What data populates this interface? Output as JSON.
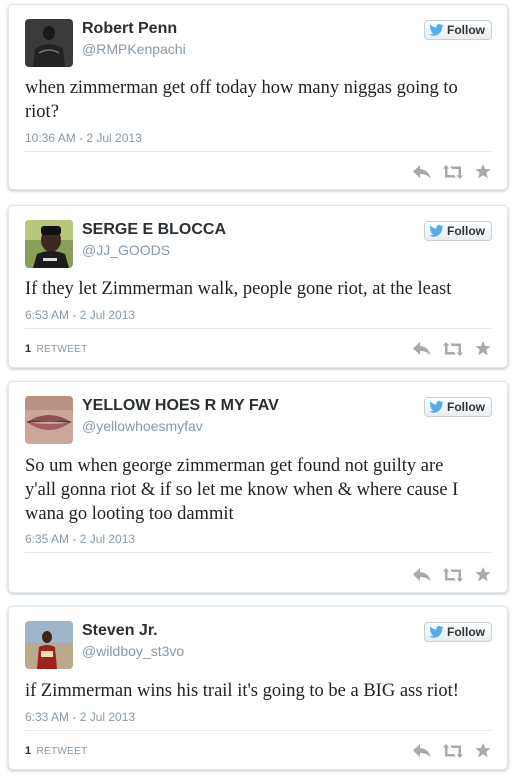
{
  "colors": {
    "follow_bird": "#55acee",
    "action_icon": "#a9a9a9",
    "handle": "#8899a6"
  },
  "tweets": [
    {
      "name": "Robert Penn",
      "handle": "@RMPKenpachi",
      "follow_label": "Follow",
      "text_lines": [
        "when zimmerman get off today how many niggas going to",
        "riot?"
      ],
      "timestamp": "10:36 AM - 2 Jul 2013",
      "retweet_count": "",
      "retweet_label": ""
    },
    {
      "name": "SERGE E BLOCCA",
      "handle": "@JJ_GOODS",
      "follow_label": "Follow",
      "text_lines": [
        "If they let Zimmerman walk, people gone riot, at the least"
      ],
      "timestamp": "6:53 AM - 2 Jul 2013",
      "retweet_count": "1",
      "retweet_label": "RETWEET"
    },
    {
      "name": "YELLOW HOES R MY FAV",
      "handle": "@yellowhoesmyfav",
      "follow_label": "Follow",
      "text_lines": [
        "So um when george zimmerman get found not guilty are",
        "y'all gonna riot & if so let me know when & where cause I",
        "wana go looting too dammit"
      ],
      "timestamp": "6:35 AM - 2 Jul 2013",
      "retweet_count": "",
      "retweet_label": ""
    },
    {
      "name": "Steven Jr.",
      "handle": "@wildboy_st3vo",
      "follow_label": "Follow",
      "text_lines": [
        "if Zimmerman wins his trail it's going to be a BIG ass riot!"
      ],
      "timestamp": "6:33 AM - 2 Jul 2013",
      "retweet_count": "1",
      "retweet_label": "RETWEET"
    }
  ]
}
